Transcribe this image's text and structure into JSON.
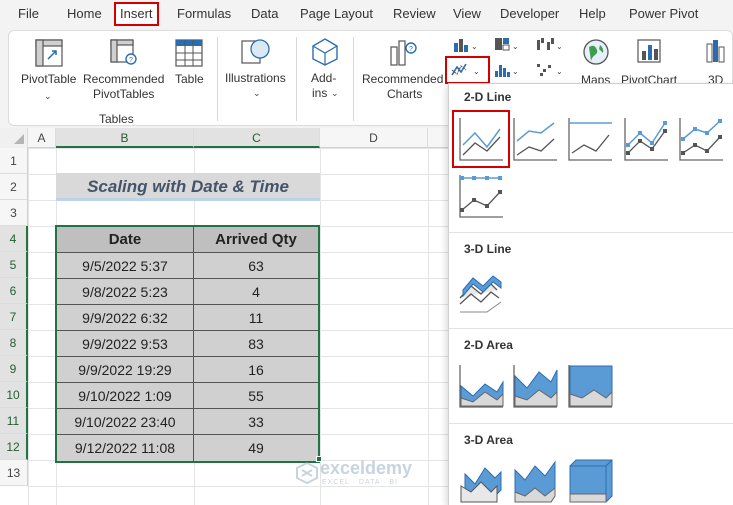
{
  "menu": {
    "items": [
      "File",
      "Home",
      "Insert",
      "Formulas",
      "Data",
      "Page Layout",
      "Review",
      "View",
      "Developer",
      "Help",
      "Power Pivot"
    ],
    "active": "Insert"
  },
  "ribbon": {
    "pivottable": "PivotTable",
    "recommended_pivottables_1": "Recommended",
    "recommended_pivottables_2": "PivotTables",
    "table": "Table",
    "tables_group": "Tables",
    "illustrations": "Illustrations",
    "addins_1": "Add-",
    "addins_2": "ins",
    "recommended_charts_1": "Recommended",
    "recommended_charts_2": "Charts",
    "maps": "Maps",
    "pivotchart": "PivotChart",
    "threed": "3D"
  },
  "grid": {
    "columns": [
      "A",
      "B",
      "C",
      "D"
    ],
    "rows": [
      "1",
      "2",
      "3",
      "4",
      "5",
      "6",
      "7",
      "8",
      "9",
      "10",
      "11",
      "12",
      "13"
    ],
    "title": "Scaling with Date & Time"
  },
  "table": {
    "headers": [
      "Date",
      "Arrived Qty"
    ],
    "rows": [
      [
        "9/5/2022 5:37",
        "63"
      ],
      [
        "9/8/2022 5:23",
        "4"
      ],
      [
        "9/9/2022 6:32",
        "11"
      ],
      [
        "9/9/2022 9:53",
        "83"
      ],
      [
        "9/9/2022 19:29",
        "16"
      ],
      [
        "9/10/2022 1:09",
        "55"
      ],
      [
        "9/10/2022 23:40",
        "33"
      ],
      [
        "9/12/2022 11:08",
        "49"
      ]
    ]
  },
  "dropdown": {
    "sections": [
      "2-D Line",
      "3-D Line",
      "2-D Area",
      "3-D Area"
    ]
  },
  "watermark": {
    "name": "exceldemy",
    "tagline": "EXCEL · DATA · BI"
  },
  "colors": {
    "accent_green": "#217346",
    "highlight_red": "#d40000",
    "chart_blue": "#5b9bd5"
  }
}
